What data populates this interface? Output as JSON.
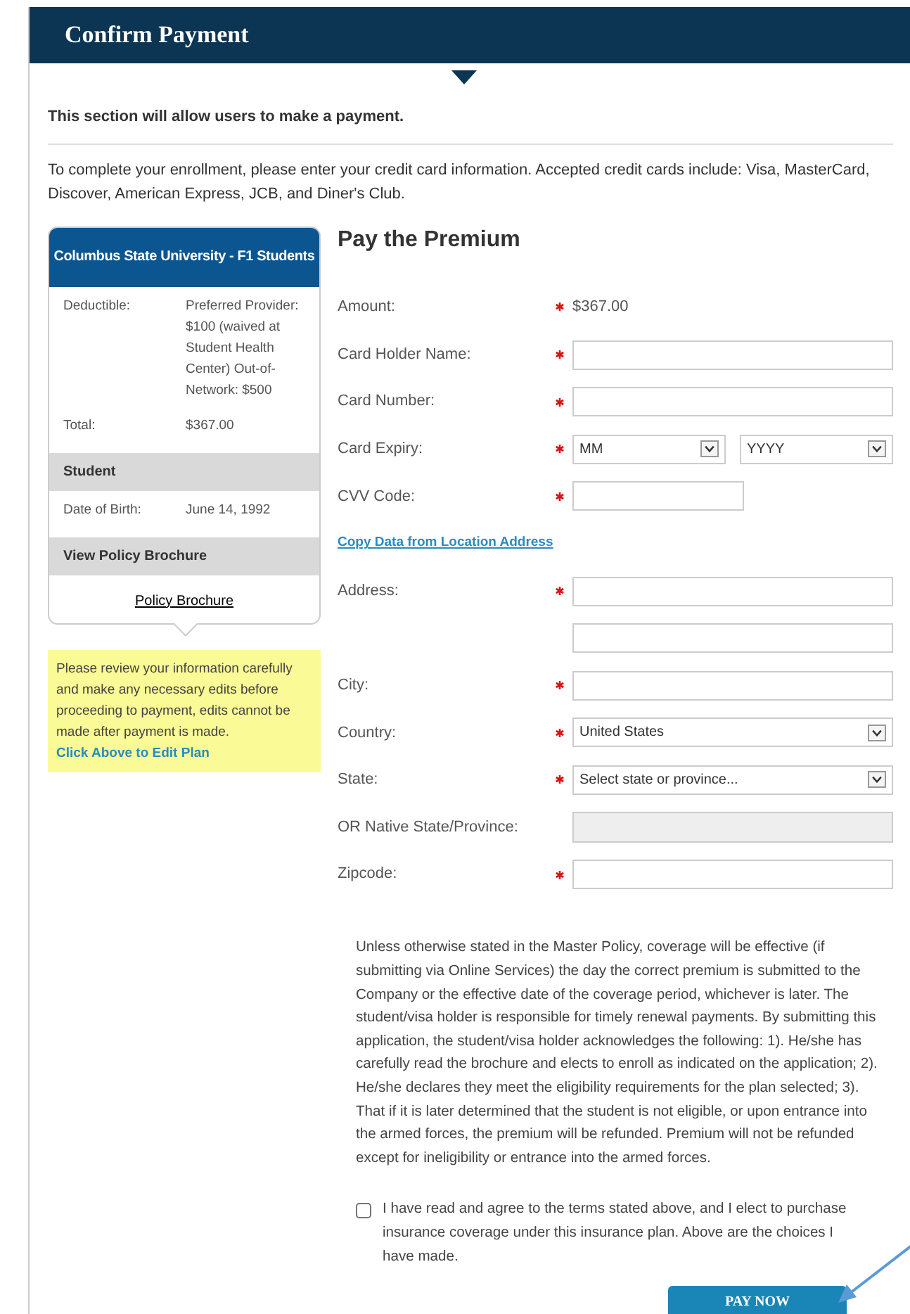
{
  "page": {
    "title": "Confirm Payment"
  },
  "intro": {
    "heading": "This section will allow users to make a payment.",
    "text": "To complete your enrollment, please enter your credit card information.  Accepted credit cards include:  Visa, MasterCard, Discover, American Express, JCB, and Diner's Club."
  },
  "plan_card": {
    "title": "Columbus State University - F1 Students",
    "details": [
      {
        "label": "Deductible:",
        "value": "Preferred Provider: $100 (waived at Student Health Center) Out-of-Network: $500"
      },
      {
        "label": "Total:",
        "value": "$367.00"
      }
    ],
    "sections": [
      {
        "heading": "Student",
        "rows": [
          {
            "label": "Date of Birth:",
            "value": "June 14, 1992"
          }
        ]
      },
      {
        "heading": "View Policy Brochure",
        "link": "Policy Brochure"
      }
    ]
  },
  "note": {
    "text": "Please review your information carefully and make any necessary edits before proceeding to payment, edits cannot be made after payment is made.",
    "link": "Click Above to Edit Plan"
  },
  "form": {
    "heading": "Pay the Premium",
    "fields": [
      {
        "kind": "static",
        "label": "Amount:",
        "required": true,
        "value": "$367.00"
      },
      {
        "kind": "text",
        "label": "Card Holder Name:",
        "required": true
      },
      {
        "kind": "text",
        "label": "Card Number:",
        "required": true
      },
      {
        "kind": "select-pair",
        "label": "Card Expiry:",
        "required": true,
        "values": [
          "MM",
          "YYYY"
        ]
      },
      {
        "kind": "short",
        "label": "CVV Code:",
        "required": true
      },
      {
        "kind": "link",
        "text": "Copy Data from Location Address"
      },
      {
        "kind": "text",
        "label": "Address:",
        "required": true
      },
      {
        "kind": "text",
        "required": false
      },
      {
        "kind": "text",
        "label": "City:",
        "required": true
      },
      {
        "kind": "select",
        "label": "Country:",
        "required": true,
        "value": "United States"
      },
      {
        "kind": "select",
        "label": "State:",
        "required": true,
        "value": "Select state or province..."
      },
      {
        "kind": "disabled",
        "label": "OR Native State/Province:",
        "required": false
      },
      {
        "kind": "text",
        "label": "Zipcode:",
        "required": true
      }
    ],
    "terms": "Unless otherwise stated in the Master Policy, coverage will be effective (if submitting via Online Services) the day the correct premium is submitted to the Company or the effective date of the coverage period, whichever is later. The student/visa holder is responsible for timely renewal payments. By submitting this application, the student/visa holder acknowledges the following: 1). He/she has carefully read the brochure and elects to enroll as indicated on the application; 2). He/she declares they meet the eligibility requirements for the plan selected; 3). That if it is later determined that the student is not eligible, or upon entrance into the armed forces, the premium will be refunded. Premium will not be refunded except for ineligibility or entrance into the armed forces.",
    "agree": {
      "label": "I have read and agree to the terms stated above, and I elect to purchase insurance coverage under this insurance plan. Above are the choices I have made.",
      "checked": false
    },
    "submit": "PAY NOW"
  }
}
